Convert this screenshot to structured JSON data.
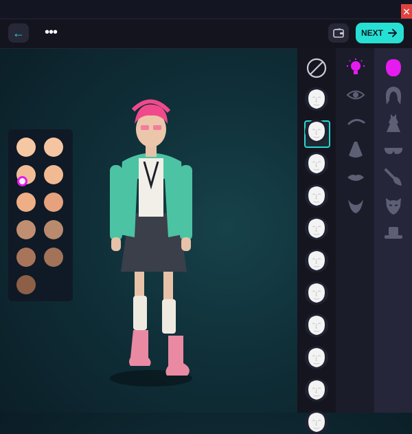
{
  "window": {
    "close_label": "✕"
  },
  "toolbar": {
    "back_icon": "arrow-left-icon",
    "more_label": "•••",
    "wallet_icon": "wallet-icon",
    "next_label": "NEXT",
    "accent_color": "#27e0d4"
  },
  "skin_tones": {
    "colors": [
      "#f6c7a3",
      "#f5c5a2",
      "#f2bd96",
      "#f2ba93",
      "#eeae86",
      "#e5a27d",
      "#c08f72",
      "#b98a6e",
      "#a8755b",
      "#a27359",
      "#8d5f47"
    ],
    "selected_index": 2,
    "marker_color": "#e51bf0"
  },
  "variants": {
    "count": 11,
    "selected_index": 1,
    "none_icon": "no-option-icon"
  },
  "features": [
    {
      "icon": "head-bulb-icon",
      "active": true
    },
    {
      "icon": "eye-icon",
      "active": false
    },
    {
      "icon": "eyebrow-icon",
      "active": false
    },
    {
      "icon": "nose-icon",
      "active": false
    },
    {
      "icon": "lips-icon",
      "active": false
    },
    {
      "icon": "beard-icon",
      "active": false
    }
  ],
  "categories": [
    {
      "icon": "head-icon",
      "active": true
    },
    {
      "icon": "hair-icon",
      "active": false
    },
    {
      "icon": "dress-icon",
      "active": false
    },
    {
      "icon": "glasses-icon",
      "active": false
    },
    {
      "icon": "makeup-brush-icon",
      "active": false
    },
    {
      "icon": "mask-icon",
      "active": false
    },
    {
      "icon": "hat-icon",
      "active": false
    }
  ]
}
